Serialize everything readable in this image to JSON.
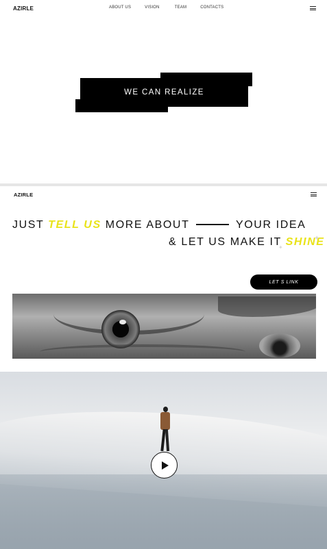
{
  "hero": {
    "logo": "AZIRLE",
    "nav": [
      "ABOUT US",
      "VISION",
      "TEAM",
      "CONTACTS"
    ],
    "headline": "WE CAN REALIZE"
  },
  "section2": {
    "logo": "AZIRLE",
    "line1": {
      "a": "JUST ",
      "accent": "TELL US",
      "b": " MORE ABOUT",
      "c": "YOUR IDEA"
    },
    "line2": {
      "a": "& LET US MAKE IT ",
      "accent": "SHINE"
    },
    "cta_label": "LET S LINK"
  },
  "icons": {
    "menu": "hamburger-icon",
    "play": "play-icon",
    "sparkle": "sparkle-icon"
  },
  "colors": {
    "accent": "#e9e319",
    "ink": "#111111",
    "block": "#000000"
  }
}
